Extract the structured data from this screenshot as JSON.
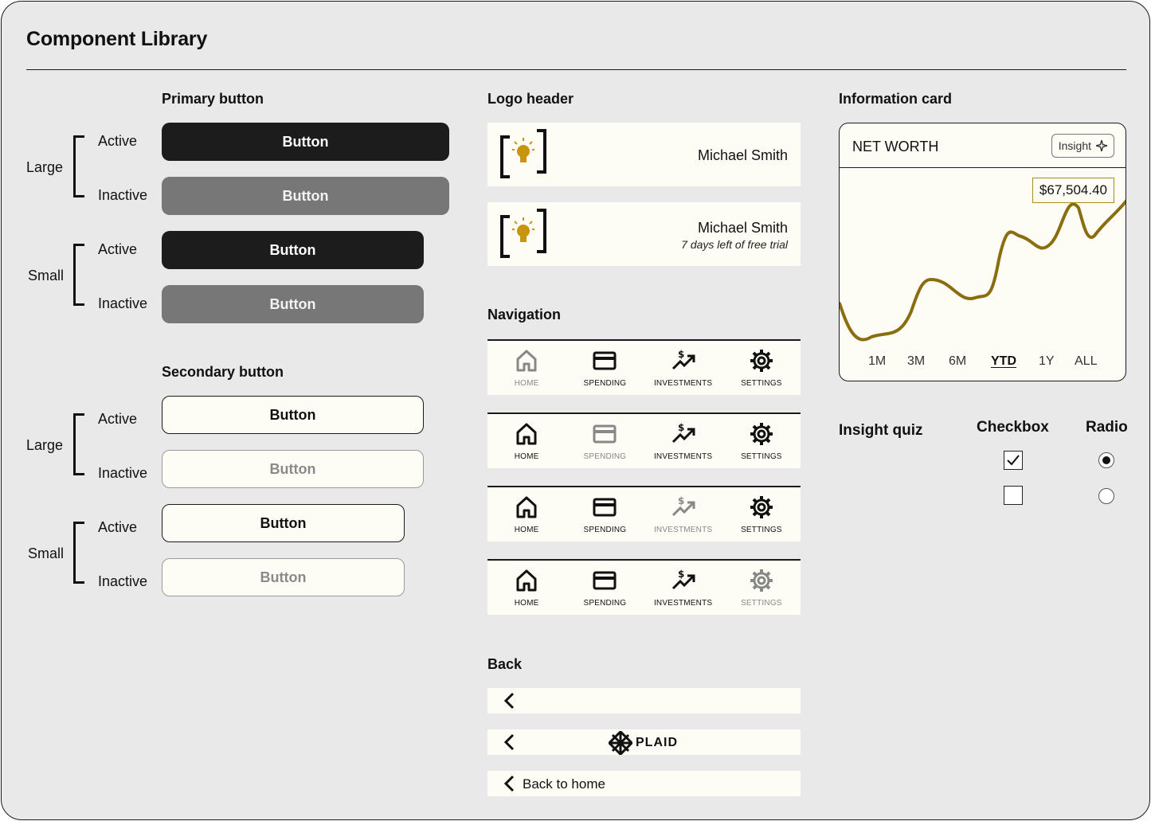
{
  "page_title": "Component Library",
  "primary": {
    "title": "Primary button",
    "large_label": "Large",
    "small_label": "Small",
    "active_label": "Active",
    "inactive_label": "Inactive",
    "button_label": "Button"
  },
  "secondary": {
    "title": "Secondary button",
    "large_label": "Large",
    "small_label": "Small",
    "active_label": "Active",
    "inactive_label": "Inactive",
    "button_label": "Button"
  },
  "logo_header": {
    "title": "Logo header",
    "user_name": "Michael Smith",
    "trial_text": "7 days left of free trial"
  },
  "navigation": {
    "title": "Navigation",
    "items": [
      "HOME",
      "SPENDING",
      "INVESTMENTS",
      "SETTINGS"
    ]
  },
  "back": {
    "title": "Back",
    "brand": "PLAID",
    "back_to_home": "Back to home"
  },
  "info_card": {
    "title": "Information card",
    "card_title": "NET WORTH",
    "insight_label": "Insight",
    "value": "$67,504.40",
    "ranges": [
      "1M",
      "3M",
      "6M",
      "YTD",
      "1Y",
      "ALL"
    ],
    "selected_range": "YTD"
  },
  "quiz": {
    "title": "Insight quiz",
    "checkbox_label": "Checkbox",
    "radio_label": "Radio"
  },
  "colors": {
    "accent_gold": "#8a6d0f",
    "dark": "#1c1c1c",
    "inactive_gray": "#777777",
    "card_bg": "#fdfcf5"
  }
}
